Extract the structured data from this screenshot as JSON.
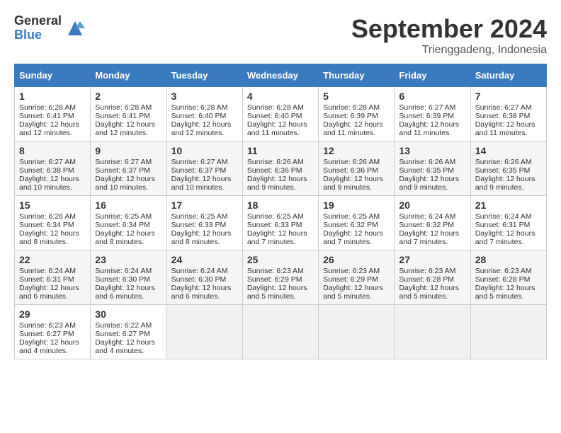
{
  "logo": {
    "general": "General",
    "blue": "Blue"
  },
  "title": {
    "month_year": "September 2024",
    "location": "Trienggadeng, Indonesia"
  },
  "headers": [
    "Sunday",
    "Monday",
    "Tuesday",
    "Wednesday",
    "Thursday",
    "Friday",
    "Saturday"
  ],
  "weeks": [
    [
      {
        "day": "1",
        "sunrise": "Sunrise: 6:28 AM",
        "sunset": "Sunset: 6:41 PM",
        "daylight": "Daylight: 12 hours and 12 minutes."
      },
      {
        "day": "2",
        "sunrise": "Sunrise: 6:28 AM",
        "sunset": "Sunset: 6:41 PM",
        "daylight": "Daylight: 12 hours and 12 minutes."
      },
      {
        "day": "3",
        "sunrise": "Sunrise: 6:28 AM",
        "sunset": "Sunset: 6:40 PM",
        "daylight": "Daylight: 12 hours and 12 minutes."
      },
      {
        "day": "4",
        "sunrise": "Sunrise: 6:28 AM",
        "sunset": "Sunset: 6:40 PM",
        "daylight": "Daylight: 12 hours and 11 minutes."
      },
      {
        "day": "5",
        "sunrise": "Sunrise: 6:28 AM",
        "sunset": "Sunset: 6:39 PM",
        "daylight": "Daylight: 12 hours and 11 minutes."
      },
      {
        "day": "6",
        "sunrise": "Sunrise: 6:27 AM",
        "sunset": "Sunset: 6:39 PM",
        "daylight": "Daylight: 12 hours and 11 minutes."
      },
      {
        "day": "7",
        "sunrise": "Sunrise: 6:27 AM",
        "sunset": "Sunset: 6:38 PM",
        "daylight": "Daylight: 12 hours and 11 minutes."
      }
    ],
    [
      {
        "day": "8",
        "sunrise": "Sunrise: 6:27 AM",
        "sunset": "Sunset: 6:38 PM",
        "daylight": "Daylight: 12 hours and 10 minutes."
      },
      {
        "day": "9",
        "sunrise": "Sunrise: 6:27 AM",
        "sunset": "Sunset: 6:37 PM",
        "daylight": "Daylight: 12 hours and 10 minutes."
      },
      {
        "day": "10",
        "sunrise": "Sunrise: 6:27 AM",
        "sunset": "Sunset: 6:37 PM",
        "daylight": "Daylight: 12 hours and 10 minutes."
      },
      {
        "day": "11",
        "sunrise": "Sunrise: 6:26 AM",
        "sunset": "Sunset: 6:36 PM",
        "daylight": "Daylight: 12 hours and 9 minutes."
      },
      {
        "day": "12",
        "sunrise": "Sunrise: 6:26 AM",
        "sunset": "Sunset: 6:36 PM",
        "daylight": "Daylight: 12 hours and 9 minutes."
      },
      {
        "day": "13",
        "sunrise": "Sunrise: 6:26 AM",
        "sunset": "Sunset: 6:35 PM",
        "daylight": "Daylight: 12 hours and 9 minutes."
      },
      {
        "day": "14",
        "sunrise": "Sunrise: 6:26 AM",
        "sunset": "Sunset: 6:35 PM",
        "daylight": "Daylight: 12 hours and 9 minutes."
      }
    ],
    [
      {
        "day": "15",
        "sunrise": "Sunrise: 6:26 AM",
        "sunset": "Sunset: 6:34 PM",
        "daylight": "Daylight: 12 hours and 8 minutes."
      },
      {
        "day": "16",
        "sunrise": "Sunrise: 6:25 AM",
        "sunset": "Sunset: 6:34 PM",
        "daylight": "Daylight: 12 hours and 8 minutes."
      },
      {
        "day": "17",
        "sunrise": "Sunrise: 6:25 AM",
        "sunset": "Sunset: 6:33 PM",
        "daylight": "Daylight: 12 hours and 8 minutes."
      },
      {
        "day": "18",
        "sunrise": "Sunrise: 6:25 AM",
        "sunset": "Sunset: 6:33 PM",
        "daylight": "Daylight: 12 hours and 7 minutes."
      },
      {
        "day": "19",
        "sunrise": "Sunrise: 6:25 AM",
        "sunset": "Sunset: 6:32 PM",
        "daylight": "Daylight: 12 hours and 7 minutes."
      },
      {
        "day": "20",
        "sunrise": "Sunrise: 6:24 AM",
        "sunset": "Sunset: 6:32 PM",
        "daylight": "Daylight: 12 hours and 7 minutes."
      },
      {
        "day": "21",
        "sunrise": "Sunrise: 6:24 AM",
        "sunset": "Sunset: 6:31 PM",
        "daylight": "Daylight: 12 hours and 7 minutes."
      }
    ],
    [
      {
        "day": "22",
        "sunrise": "Sunrise: 6:24 AM",
        "sunset": "Sunset: 6:31 PM",
        "daylight": "Daylight: 12 hours and 6 minutes."
      },
      {
        "day": "23",
        "sunrise": "Sunrise: 6:24 AM",
        "sunset": "Sunset: 6:30 PM",
        "daylight": "Daylight: 12 hours and 6 minutes."
      },
      {
        "day": "24",
        "sunrise": "Sunrise: 6:24 AM",
        "sunset": "Sunset: 6:30 PM",
        "daylight": "Daylight: 12 hours and 6 minutes."
      },
      {
        "day": "25",
        "sunrise": "Sunrise: 6:23 AM",
        "sunset": "Sunset: 6:29 PM",
        "daylight": "Daylight: 12 hours and 5 minutes."
      },
      {
        "day": "26",
        "sunrise": "Sunrise: 6:23 AM",
        "sunset": "Sunset: 6:29 PM",
        "daylight": "Daylight: 12 hours and 5 minutes."
      },
      {
        "day": "27",
        "sunrise": "Sunrise: 6:23 AM",
        "sunset": "Sunset: 6:28 PM",
        "daylight": "Daylight: 12 hours and 5 minutes."
      },
      {
        "day": "28",
        "sunrise": "Sunrise: 6:23 AM",
        "sunset": "Sunset: 6:28 PM",
        "daylight": "Daylight: 12 hours and 5 minutes."
      }
    ],
    [
      {
        "day": "29",
        "sunrise": "Sunrise: 6:23 AM",
        "sunset": "Sunset: 6:27 PM",
        "daylight": "Daylight: 12 hours and 4 minutes."
      },
      {
        "day": "30",
        "sunrise": "Sunrise: 6:22 AM",
        "sunset": "Sunset: 6:27 PM",
        "daylight": "Daylight: 12 hours and 4 minutes."
      },
      null,
      null,
      null,
      null,
      null
    ]
  ]
}
